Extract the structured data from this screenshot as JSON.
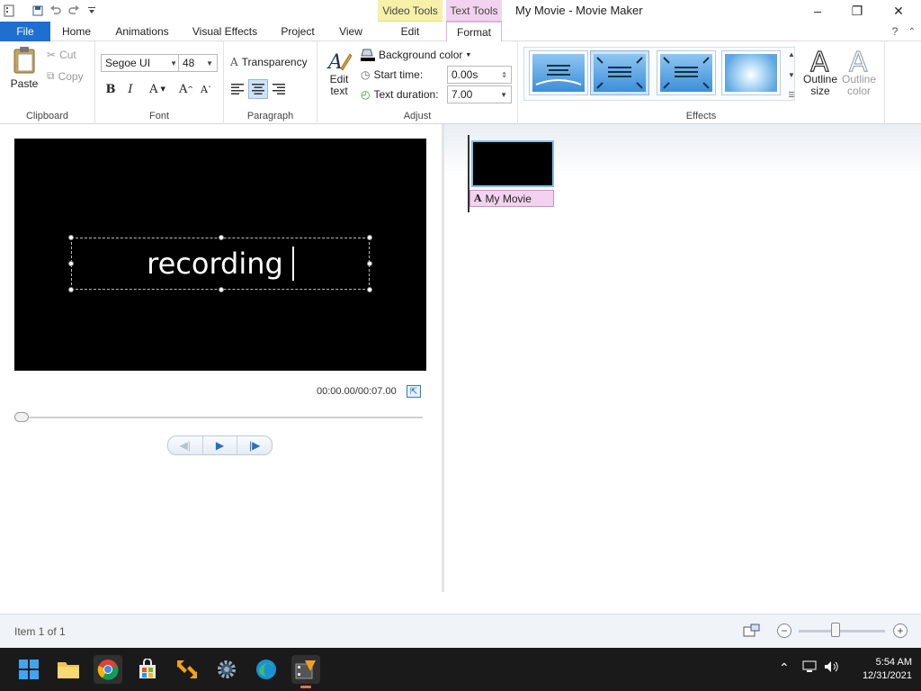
{
  "window": {
    "title": "My Movie - Movie Maker",
    "context_tabs": {
      "video_tools": "Video Tools",
      "text_tools": "Text Tools"
    },
    "controls": {
      "minimize": "–",
      "maximize": "❐",
      "close": "✕"
    }
  },
  "tabs": [
    "File",
    "Home",
    "Animations",
    "Visual Effects",
    "Project",
    "View",
    "Edit",
    "Format"
  ],
  "active_tab": "Format",
  "ribbon": {
    "clipboard": {
      "paste": "Paste",
      "cut": "Cut",
      "copy": "Copy",
      "label": "Clipboard"
    },
    "font": {
      "family": "Segoe UI",
      "size": "48",
      "label": "Font",
      "bold": "B",
      "italic": "I",
      "color": "A",
      "grow": "A",
      "shrink": "A"
    },
    "paragraph": {
      "transparency": "Transparency",
      "label": "Paragraph"
    },
    "adjust": {
      "edit_text": "Edit text",
      "background_color": "Background color",
      "start_time_label": "Start time:",
      "start_time_value": "0.00s",
      "text_duration_label": "Text duration:",
      "text_duration_value": "7.00",
      "label": "Adjust"
    },
    "effects": {
      "label": "Effects",
      "outline_size": "Outline size",
      "outline_color": "Outline color"
    }
  },
  "preview": {
    "overlay_text": "recording",
    "timecode": "00:00.00/00:07.00"
  },
  "storyboard": {
    "clip_caption": "My Movie"
  },
  "status": {
    "item": "Item 1 of 1"
  },
  "clock": {
    "time": "5:54 AM",
    "date": "12/31/2021"
  },
  "colors": {
    "file_tab": "#1e6fcf",
    "video_tools": "#f7f0a8",
    "text_tools": "#f2d3ef",
    "taskbar": "#1a1a1a"
  }
}
